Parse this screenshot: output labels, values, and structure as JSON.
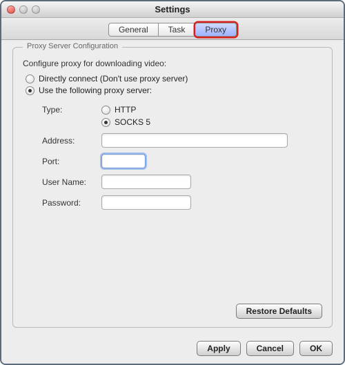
{
  "window": {
    "title": "Settings"
  },
  "tabs": {
    "general": "General",
    "task": "Task",
    "proxy": "Proxy"
  },
  "proxy": {
    "group_title": "Proxy Server Configuration",
    "desc": "Configure proxy for downloading video:",
    "mode_direct": "Directly connect (Don't use proxy server)",
    "mode_use": "Use the following proxy server:",
    "type_label": "Type:",
    "type_http": "HTTP",
    "type_socks5": "SOCKS 5",
    "address_label": "Address:",
    "address_value": "",
    "port_label": "Port:",
    "port_value": "",
    "user_label": "User Name:",
    "user_value": "",
    "pass_label": "Password:",
    "pass_value": "",
    "restore": "Restore Defaults"
  },
  "buttons": {
    "apply": "Apply",
    "cancel": "Cancel",
    "ok": "OK"
  }
}
